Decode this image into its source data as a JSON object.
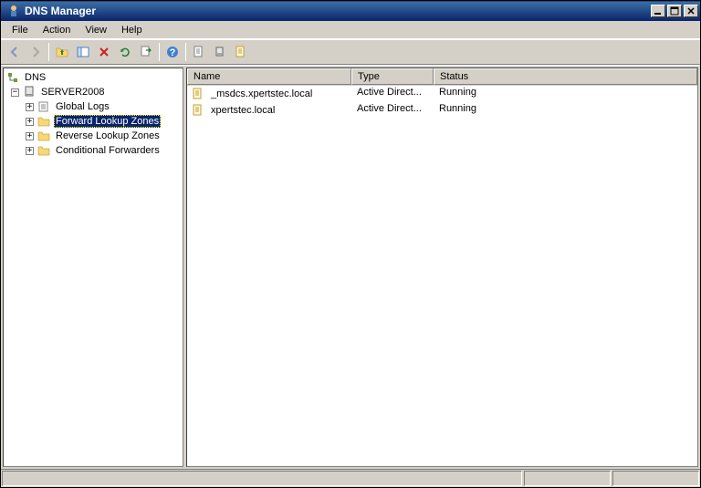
{
  "window": {
    "title": "DNS Manager"
  },
  "menu": {
    "file": "File",
    "action": "Action",
    "view": "View",
    "help": "Help"
  },
  "tree": {
    "root": "DNS",
    "server": "SERVER2008",
    "children": [
      {
        "label": "Global Logs"
      },
      {
        "label": "Forward Lookup Zones"
      },
      {
        "label": "Reverse Lookup Zones"
      },
      {
        "label": "Conditional Forwarders"
      }
    ]
  },
  "columns": {
    "name": "Name",
    "type": "Type",
    "status": "Status"
  },
  "rows": [
    {
      "name": "_msdcs.xpertstec.local",
      "type": "Active Direct...",
      "status": "Running"
    },
    {
      "name": "xpertstec.local",
      "type": "Active Direct...",
      "status": "Running"
    }
  ]
}
